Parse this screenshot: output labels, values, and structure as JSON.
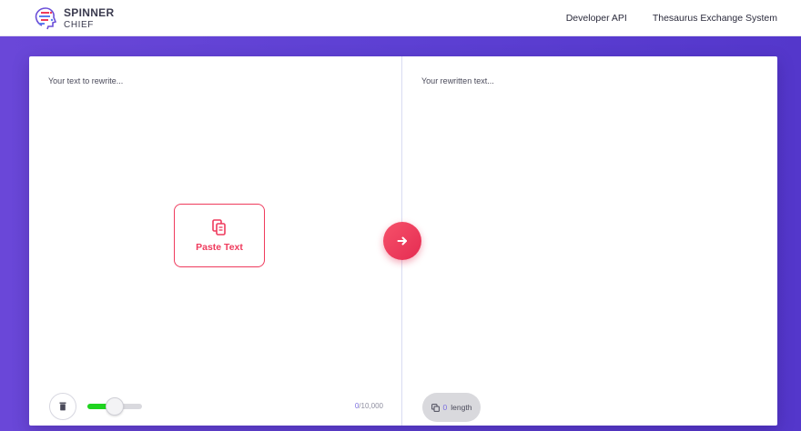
{
  "brand": {
    "line1": "SPINNER",
    "line2": "CHIEF"
  },
  "nav": {
    "items": [
      {
        "label": "Developer API"
      },
      {
        "label": "Thesaurus Exchange System"
      }
    ]
  },
  "input_pane": {
    "placeholder": "Your text to rewrite...",
    "paste_label": "Paste Text",
    "counter_current": "0",
    "counter_max": "/10,000",
    "slider_level_percent": 50,
    "icons": {
      "paste": "paste-icon",
      "trash": "trash-icon"
    }
  },
  "output_pane": {
    "placeholder": "Your rewritten text...",
    "length_value": "0",
    "length_label": "length",
    "icons": {
      "copy": "copy-icon"
    }
  },
  "action": {
    "icon": "arrow-right-icon"
  },
  "colors": {
    "accent": "#ef3b5d",
    "background": "#5a3fd2",
    "slider_fill": "#1fd41f",
    "counter_accent": "#7c6fe0"
  }
}
